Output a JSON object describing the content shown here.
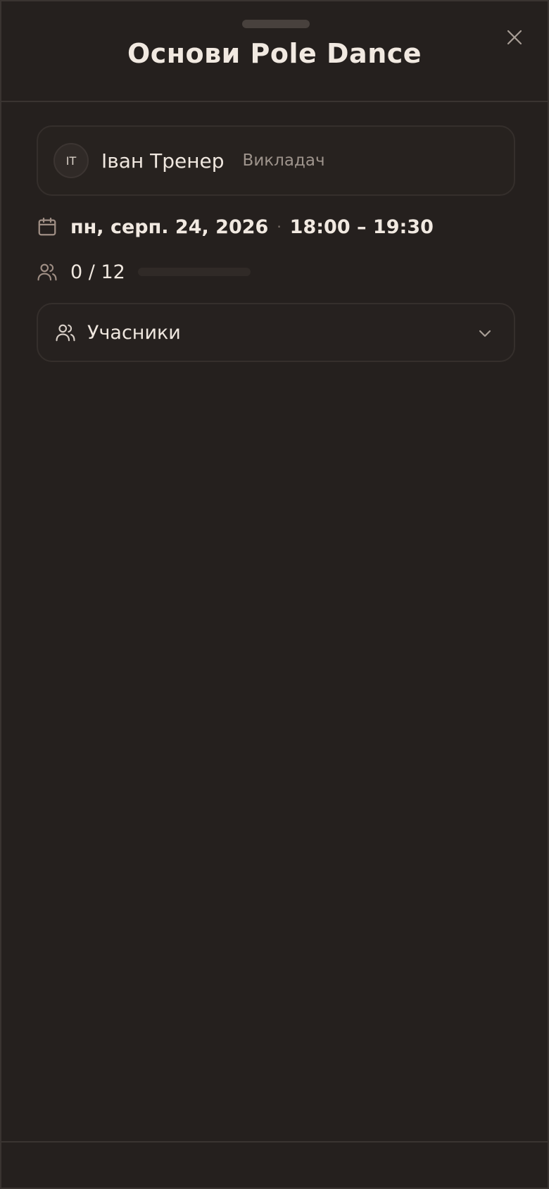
{
  "sheet": {
    "title": "Основи Pole Dance",
    "close_icon": "close-icon"
  },
  "teacher": {
    "initials": "IT",
    "name": "Іван Тренер",
    "role": "Викладач"
  },
  "schedule": {
    "date": "пн, серп. 24, 2026",
    "separator": "·",
    "time": "18:00 – 19:30",
    "icon": "calendar-icon"
  },
  "capacity": {
    "label": "0 / 12",
    "booked": 0,
    "total": 12,
    "icon": "users-icon"
  },
  "participants": {
    "label": "Учасники",
    "icon": "users-icon",
    "toggle_icon": "chevron-down-icon"
  },
  "colors": {
    "background": "#25201e",
    "text": "#efe7df",
    "muted": "#9e948c",
    "border": "#352f2c"
  }
}
